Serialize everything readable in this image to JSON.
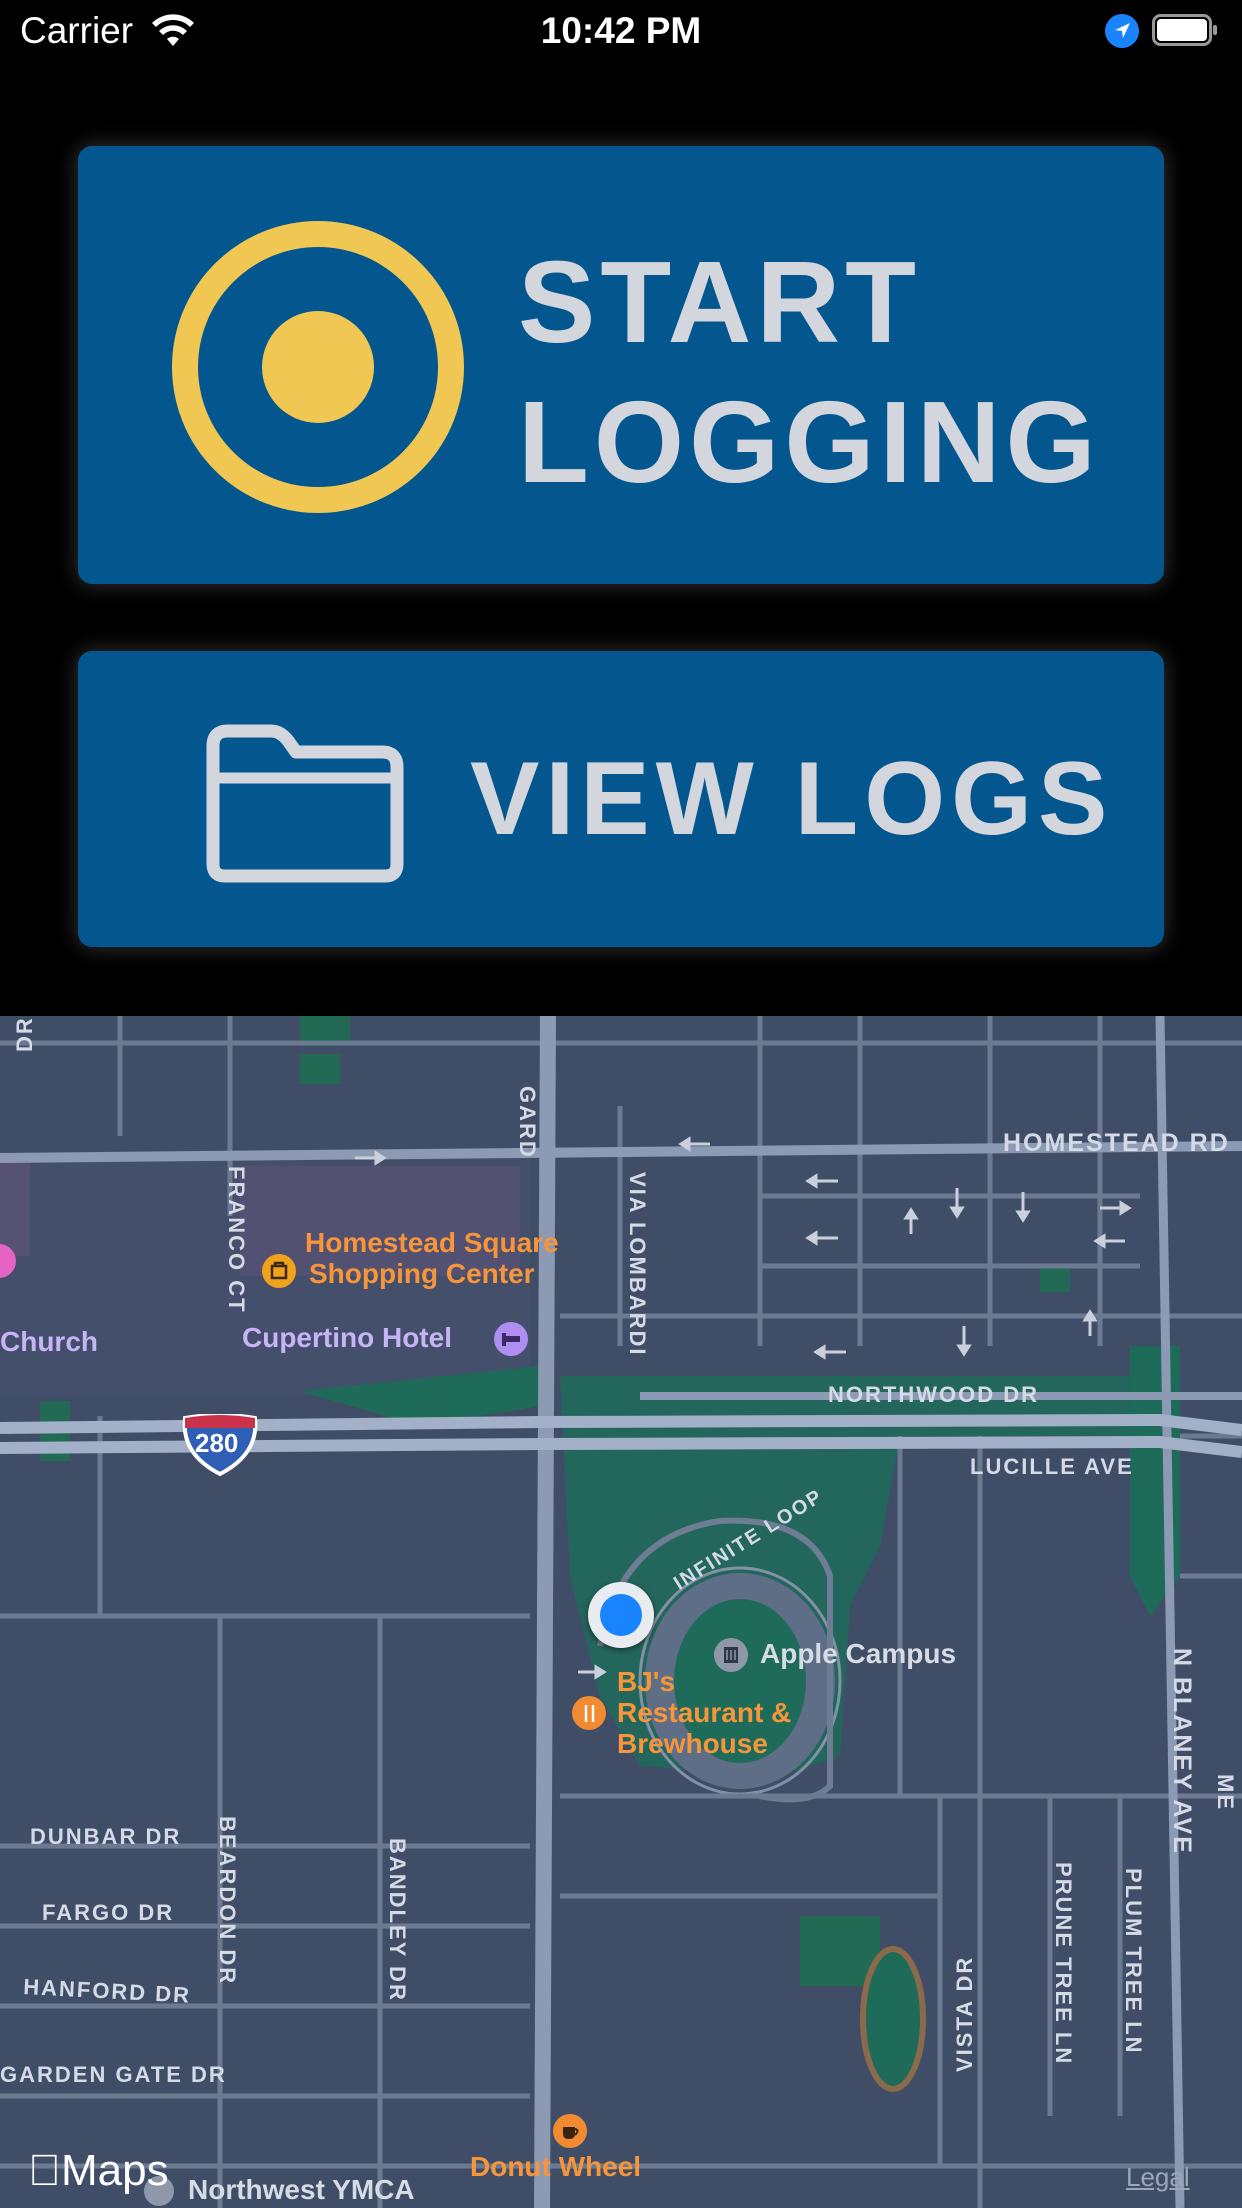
{
  "status_bar": {
    "carrier": "Carrier",
    "time": "10:42 PM"
  },
  "actions": {
    "start_line1": "START",
    "start_line2": "LOGGING",
    "view_logs": "VIEW LOGS"
  },
  "map": {
    "streets": {
      "homestead": "HOMESTEAD RD",
      "northwood": "NORTHWOOD DR",
      "lucille": "LUCILLE AVE",
      "infinite": "INFINITE LOOP",
      "via_lombardi": "VIA LOMBARDI",
      "franco": "FRANCO CT",
      "de_anza": "GARD",
      "dr_left": "DR",
      "dunbar": "DUNBAR DR",
      "fargo": "FARGO DR",
      "hanford": "HANFORD DR",
      "garden_gate": "GARDEN GATE DR",
      "beardon": "BEARDON DR",
      "bandley": "BANDLEY DR",
      "vista": "VISTA DR",
      "prune_tree": "PRUNE TREE LN",
      "plum_tree": "PLUM TREE LN",
      "blaney": "N BLANEY AVE",
      "me": "ME"
    },
    "highway_number": "280",
    "pois": {
      "homestead_square_1": "Homestead Square",
      "homestead_square_2": "Shopping Center",
      "cupertino_hotel": "Cupertino Hotel",
      "church": "Church",
      "apple_campus": "Apple Campus",
      "bjs_1": "BJ's",
      "bjs_2": "Restaurant &",
      "bjs_3": "Brewhouse",
      "donut_wheel": "Donut Wheel",
      "ymca": "Northwest YMCA"
    },
    "attribution": "Maps",
    "legal": "Legal"
  },
  "colors": {
    "button_bg": "#04568e",
    "start_icon": "#f0c752",
    "label": "#d3d6dc",
    "map_bg": "#3f4e66",
    "user_location": "#1a84ff"
  }
}
